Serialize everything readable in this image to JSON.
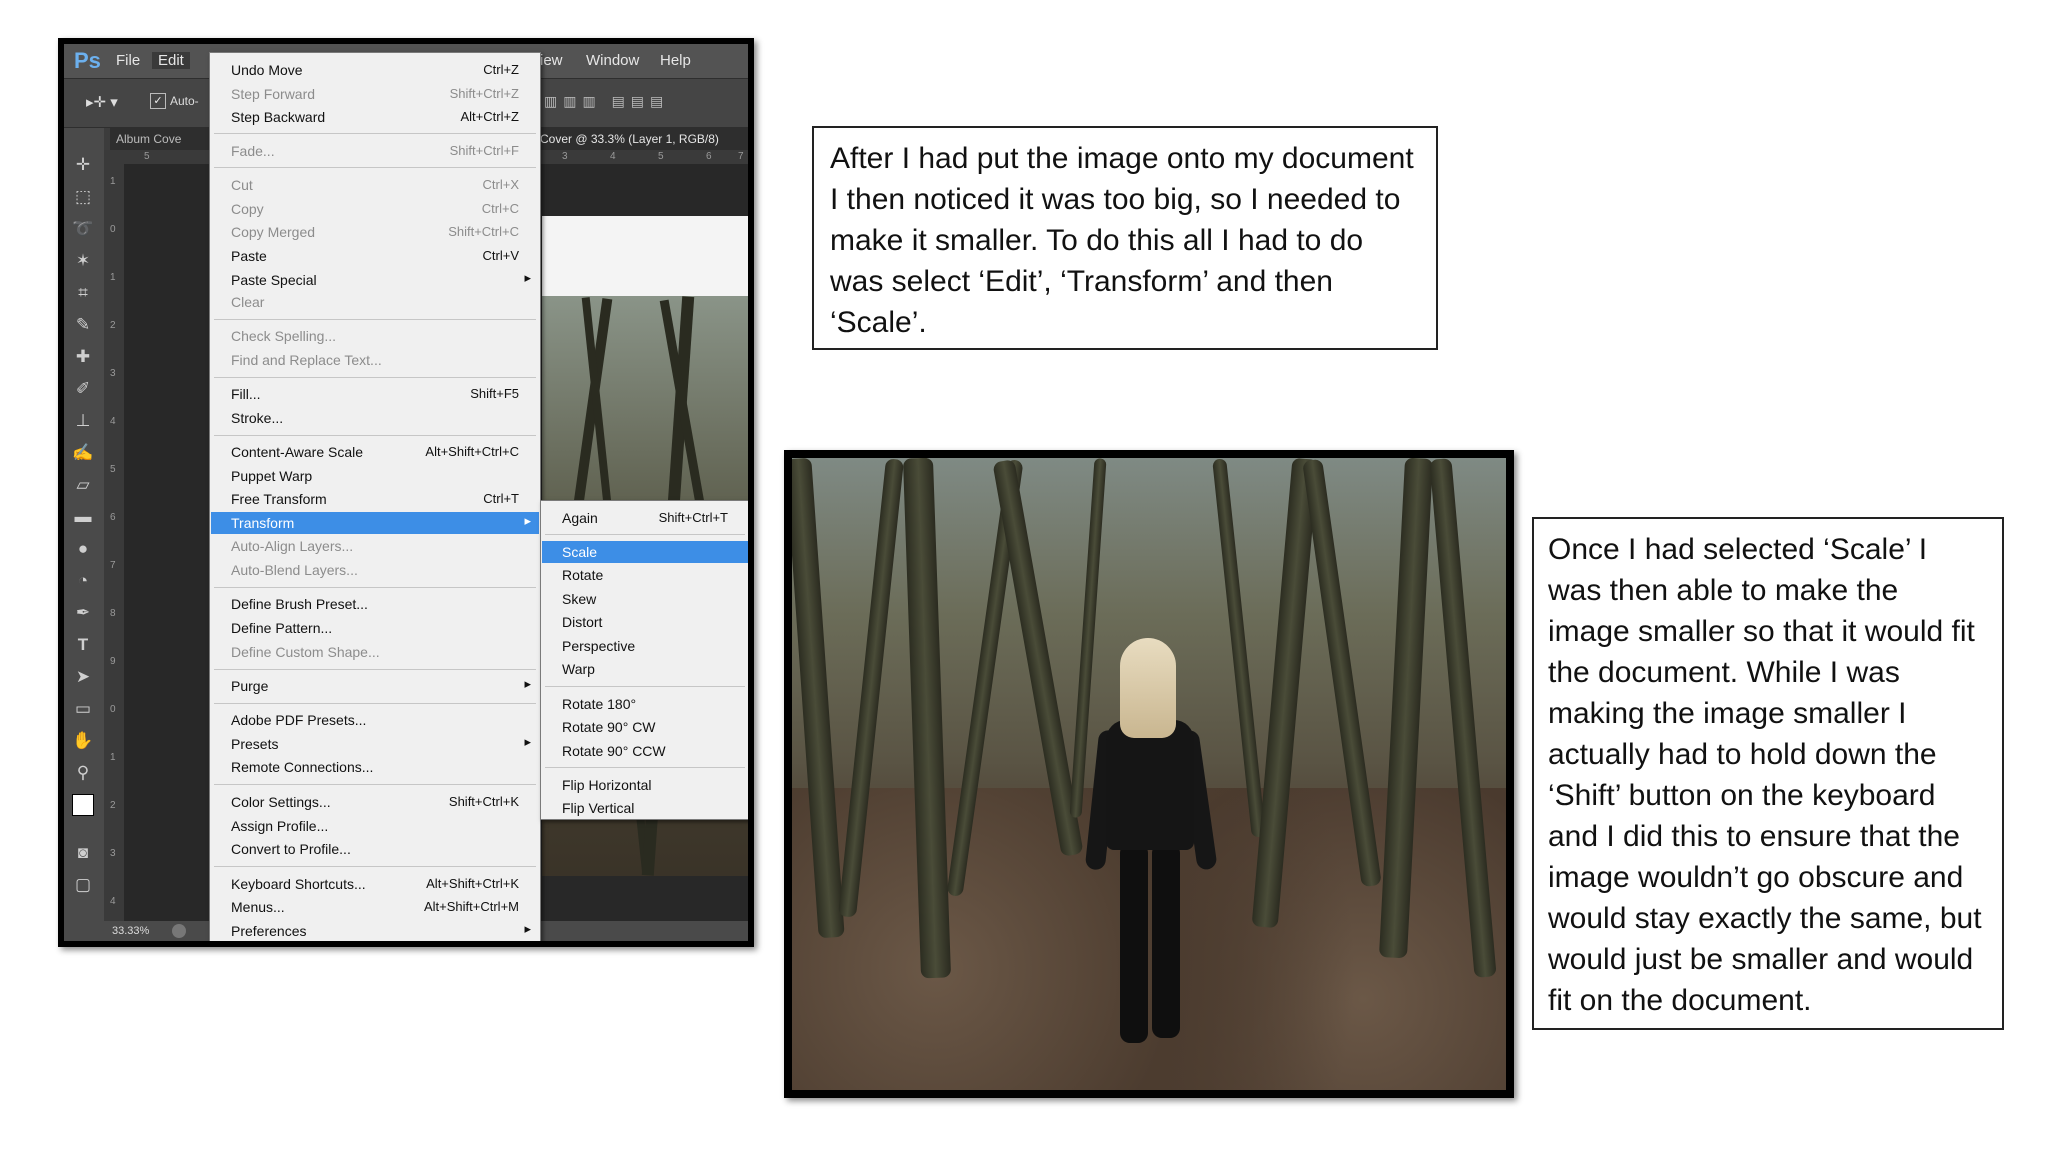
{
  "photoshop": {
    "logo": "Ps",
    "menubar": [
      "File",
      "Edit",
      "iew",
      "Window",
      "Help"
    ],
    "options_text": "Auto-",
    "doc_tab_left": "Album Cove",
    "doc_tab_right": "Cover @ 33.3% (Layer 1, RGB/8)",
    "ruler_top": [
      "5",
      "3",
      "4",
      "5",
      "6",
      "7"
    ],
    "ruler_left": [
      "1",
      "0",
      "1",
      "2",
      "3",
      "4",
      "5",
      "6",
      "7",
      "8",
      "9",
      "0",
      "1",
      "2",
      "3",
      "4"
    ],
    "zoom": "33.33%"
  },
  "edit_menu": {
    "items": [
      {
        "label": "Undo Move",
        "shortcut": "Ctrl+Z"
      },
      {
        "label": "Step Forward",
        "shortcut": "Shift+Ctrl+Z"
      },
      {
        "label": "Step Backward",
        "shortcut": "Alt+Ctrl+Z"
      },
      {
        "label": "Fade...",
        "shortcut": "Shift+Ctrl+F"
      },
      {
        "label": "Cut",
        "shortcut": "Ctrl+X"
      },
      {
        "label": "Copy",
        "shortcut": "Ctrl+C"
      },
      {
        "label": "Copy Merged",
        "shortcut": "Shift+Ctrl+C"
      },
      {
        "label": "Paste",
        "shortcut": "Ctrl+V"
      },
      {
        "label": "Paste Special",
        "shortcut": ""
      },
      {
        "label": "Clear",
        "shortcut": ""
      },
      {
        "label": "Check Spelling...",
        "shortcut": ""
      },
      {
        "label": "Find and Replace Text...",
        "shortcut": ""
      },
      {
        "label": "Fill...",
        "shortcut": "Shift+F5"
      },
      {
        "label": "Stroke...",
        "shortcut": ""
      },
      {
        "label": "Content-Aware Scale",
        "shortcut": "Alt+Shift+Ctrl+C"
      },
      {
        "label": "Puppet Warp",
        "shortcut": ""
      },
      {
        "label": "Free Transform",
        "shortcut": "Ctrl+T"
      },
      {
        "label": "Transform",
        "shortcut": ""
      },
      {
        "label": "Auto-Align Layers...",
        "shortcut": ""
      },
      {
        "label": "Auto-Blend Layers...",
        "shortcut": ""
      },
      {
        "label": "Define Brush Preset...",
        "shortcut": ""
      },
      {
        "label": "Define Pattern...",
        "shortcut": ""
      },
      {
        "label": "Define Custom Shape...",
        "shortcut": ""
      },
      {
        "label": "Purge",
        "shortcut": ""
      },
      {
        "label": "Adobe PDF Presets...",
        "shortcut": ""
      },
      {
        "label": "Presets",
        "shortcut": ""
      },
      {
        "label": "Remote Connections...",
        "shortcut": ""
      },
      {
        "label": "Color Settings...",
        "shortcut": "Shift+Ctrl+K"
      },
      {
        "label": "Assign Profile...",
        "shortcut": ""
      },
      {
        "label": "Convert to Profile...",
        "shortcut": ""
      },
      {
        "label": "Keyboard Shortcuts...",
        "shortcut": "Alt+Shift+Ctrl+K"
      },
      {
        "label": "Menus...",
        "shortcut": "Alt+Shift+Ctrl+M"
      },
      {
        "label": "Preferences",
        "shortcut": ""
      }
    ]
  },
  "transform_menu": {
    "items": [
      {
        "label": "Again",
        "shortcut": "Shift+Ctrl+T"
      },
      {
        "label": "Scale",
        "shortcut": ""
      },
      {
        "label": "Rotate",
        "shortcut": ""
      },
      {
        "label": "Skew",
        "shortcut": ""
      },
      {
        "label": "Distort",
        "shortcut": ""
      },
      {
        "label": "Perspective",
        "shortcut": ""
      },
      {
        "label": "Warp",
        "shortcut": ""
      },
      {
        "label": "Rotate 180°",
        "shortcut": ""
      },
      {
        "label": "Rotate 90° CW",
        "shortcut": ""
      },
      {
        "label": "Rotate 90° CCW",
        "shortcut": ""
      },
      {
        "label": "Flip Horizontal",
        "shortcut": ""
      },
      {
        "label": "Flip Vertical",
        "shortcut": ""
      }
    ]
  },
  "text_box_1": "After I had put the image onto my document I then noticed it was too big, so I needed to make it smaller. To do this all I had to do was select ‘Edit’, ‘Transform’ and then ‘Scale’.",
  "text_box_2": "Once I had selected ‘Scale’ I was then able to make the image smaller so that it would fit the document. While I was making the image smaller I actually had to hold down the ‘Shift’ button on the keyboard and I did this to ensure that the image wouldn’t go obscure and would stay exactly the same, but would just be smaller and would fit on the document.",
  "colors": {
    "highlight": "#3d8ee6",
    "menu_bg": "#f0f0f0",
    "ps_blue": "#6cb0ee"
  }
}
